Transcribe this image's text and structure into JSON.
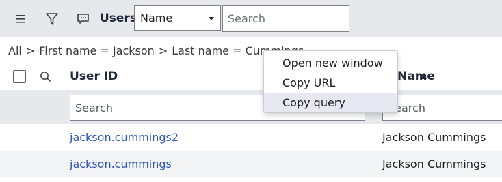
{
  "toolbar": {
    "menu_icon": "hamburger-menu-icon",
    "filter_icon": "filter-icon",
    "chat_icon": "chat-bubble-icon",
    "title": "Users",
    "field_select_value": "Name",
    "search_placeholder": "Search"
  },
  "breadcrumb": {
    "items": [
      "All",
      "First name = Jackson",
      "Last name = Cummings"
    ],
    "separator": ">"
  },
  "table": {
    "columns": [
      {
        "label": "User ID"
      },
      {
        "label": "Name",
        "sort": "ascending"
      }
    ],
    "filter_placeholders": [
      "Search",
      "Search"
    ],
    "rows": [
      {
        "user_id": "jackson.cummings2",
        "name": "Jackson Cummings"
      },
      {
        "user_id": "jackson.cummings",
        "name": "Jackson Cummings"
      }
    ]
  },
  "context_menu": {
    "items": [
      "Open new window",
      "Copy URL",
      "Copy query"
    ],
    "highlighted": "Copy query"
  },
  "colors": {
    "toolbar_bg": "#e6e8eb",
    "link": "#2e54b8",
    "menu_highlight": "#e7e8f2"
  }
}
